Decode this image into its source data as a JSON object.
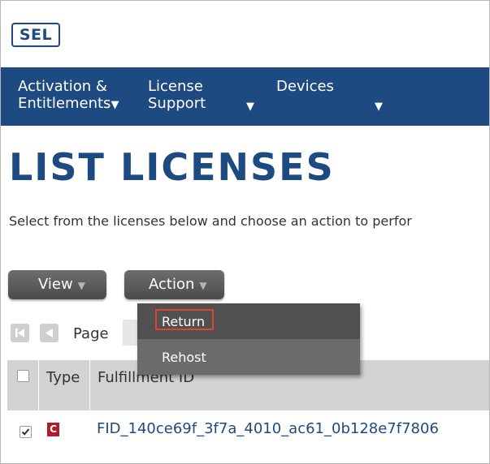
{
  "header": {
    "logo_text": "SEL"
  },
  "nav": {
    "items": [
      {
        "label_line1": "Activation &",
        "label_line2": "Entitlements"
      },
      {
        "label_line1": "License",
        "label_line2": "Support"
      },
      {
        "label_line1": "Devices",
        "label_line2": ""
      }
    ]
  },
  "page": {
    "title": "LIST LICENSES",
    "instructions": "Select from the licenses below and choose an action to perfor"
  },
  "toolbar": {
    "view_label": "View",
    "action_label": "Action"
  },
  "action_menu": {
    "items": [
      "Return",
      "Rehost"
    ],
    "highlighted_index": 0
  },
  "pager": {
    "label": "Page"
  },
  "table": {
    "columns": [
      "Type",
      "Fulfillment ID"
    ],
    "rows": [
      {
        "checked": true,
        "type_badge": "C",
        "fulfillment_id": "FID_140ce69f_3f7a_4010_ac61_0b128e7f7806"
      }
    ]
  },
  "colors": {
    "brand_blue": "#1d4a80",
    "badge_red": "#b01c2e",
    "highlight_box": "#e2432b"
  }
}
